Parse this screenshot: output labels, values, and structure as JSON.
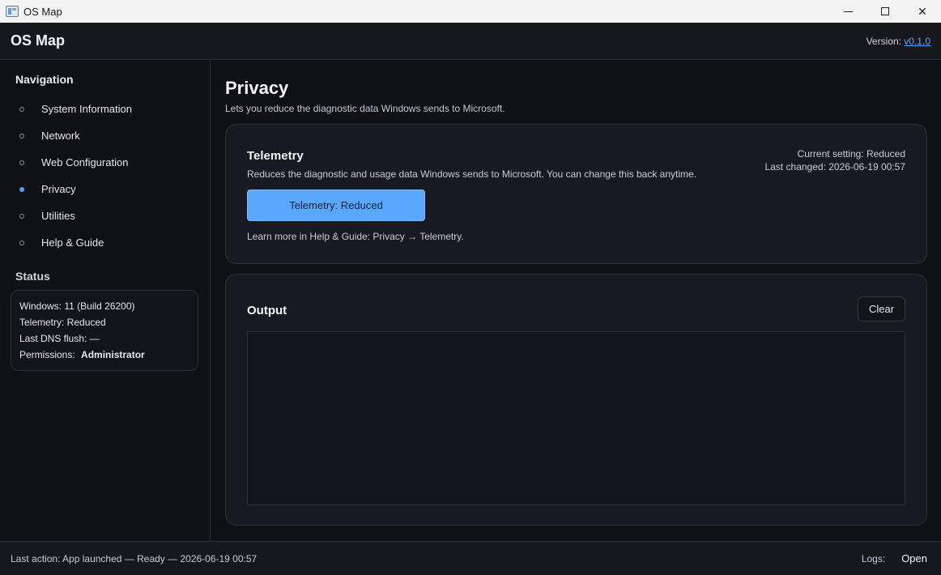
{
  "window": {
    "title": "OS Map"
  },
  "header": {
    "app_title": "OS Map",
    "version_label": "Version:",
    "version_link": "v0.1.0"
  },
  "sidebar": {
    "nav_heading": "Navigation",
    "items": [
      {
        "label": "System Information",
        "active": false
      },
      {
        "label": "Network",
        "active": false
      },
      {
        "label": "Web Configuration",
        "active": false
      },
      {
        "label": "Privacy",
        "active": true
      },
      {
        "label": "Utilities",
        "active": false
      },
      {
        "label": "Help & Guide",
        "active": false
      }
    ],
    "status_heading": "Status",
    "status": {
      "windows": "Windows: 11 (Build 26200)",
      "telemetry": "Telemetry: Reduced",
      "dns": "Last DNS flush: —",
      "permissions_label": "Permissions:",
      "permissions_value": "Administrator"
    }
  },
  "main": {
    "title": "Privacy",
    "subtitle": "Lets you reduce the diagnostic data Windows sends to Microsoft.",
    "telemetry": {
      "title": "Telemetry",
      "description": "Reduces the diagnostic and usage data Windows sends to Microsoft. You can change this back anytime.",
      "current_setting": "Current setting: Reduced",
      "last_changed": "Last changed: 2026-06-19 00:57",
      "button_label": "Telemetry: Reduced",
      "learn_more": "Learn more in Help & Guide: Privacy → Telemetry."
    },
    "output": {
      "title": "Output",
      "clear_label": "Clear",
      "content": ""
    }
  },
  "footer": {
    "last_action": "Last action: App launched — Ready — 2026-06-19 00:57",
    "logs_label": "Logs:",
    "open_label": "Open"
  },
  "colors": {
    "accent": "#5aa7ff",
    "active_dot": "#4aa3ff",
    "background": "#0f1115"
  }
}
